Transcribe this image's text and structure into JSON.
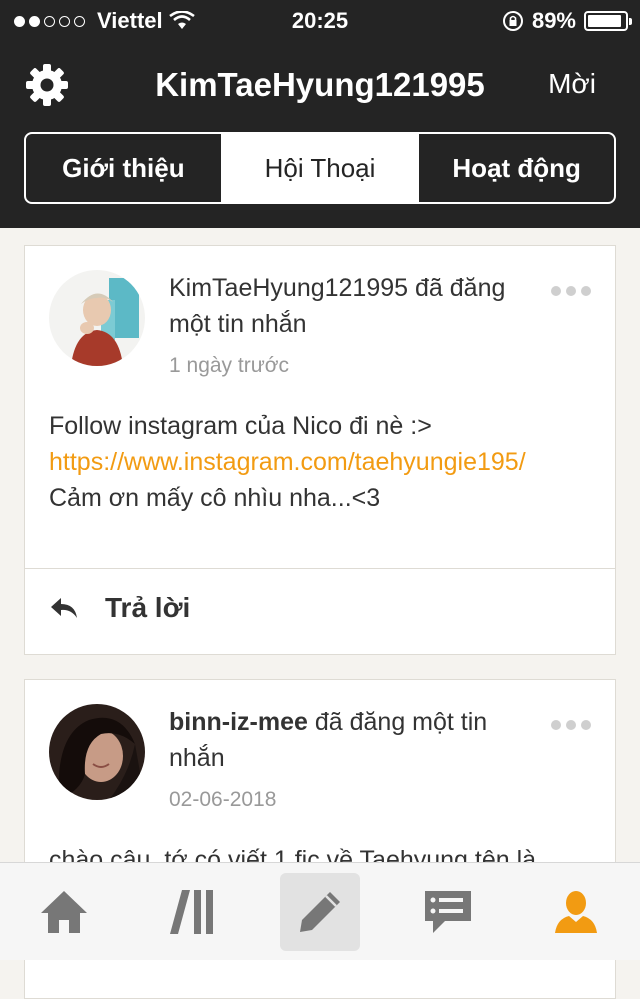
{
  "status": {
    "carrier": "Viettel",
    "time": "20:25",
    "battery": "89%",
    "battery_level": 0.89,
    "signal_bars": 2
  },
  "nav": {
    "title": "KimTaeHyung121995",
    "invite_label": "Mời"
  },
  "tabs": [
    {
      "label": "Giới thiệu",
      "active": false
    },
    {
      "label": "Hội Thoại",
      "active": true
    },
    {
      "label": "Hoạt động",
      "active": false
    }
  ],
  "posts": [
    {
      "author": "KimTaeHyung121995",
      "action": " đã đăng một tin nhắn",
      "time": "1 ngày trước",
      "line1": "Follow instagram của Nico đi nè :>",
      "link": "https://www.instagram.com/taehyungie195/",
      "line3": "Cảm ơn mấy cô nhìu nha...<3",
      "reply_label": "Trả lời"
    },
    {
      "author": "binn-iz-mee",
      "action": " đã đăng một tin nhắn",
      "time": "02-06-2018",
      "line1": "chào cậu, tớ có viết 1 fic về Taehyung tên là"
    }
  ],
  "bottom_tabs": [
    {
      "icon": "home-icon"
    },
    {
      "icon": "library-icon"
    },
    {
      "icon": "write-icon",
      "active": true
    },
    {
      "icon": "messages-icon"
    },
    {
      "icon": "profile-icon"
    }
  ],
  "colors": {
    "accent": "#f29b12",
    "header": "#242424"
  }
}
